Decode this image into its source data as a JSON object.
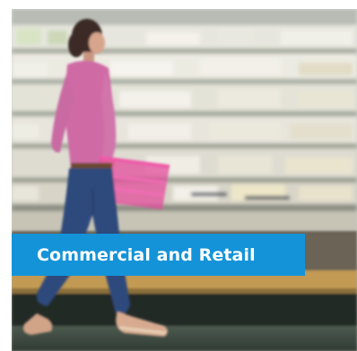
{
  "tile": {
    "label": "Commercial and Retail",
    "accent_color": "#1493d8",
    "photo_subject": "shopper-walking-past-refrigerated-shelves"
  }
}
